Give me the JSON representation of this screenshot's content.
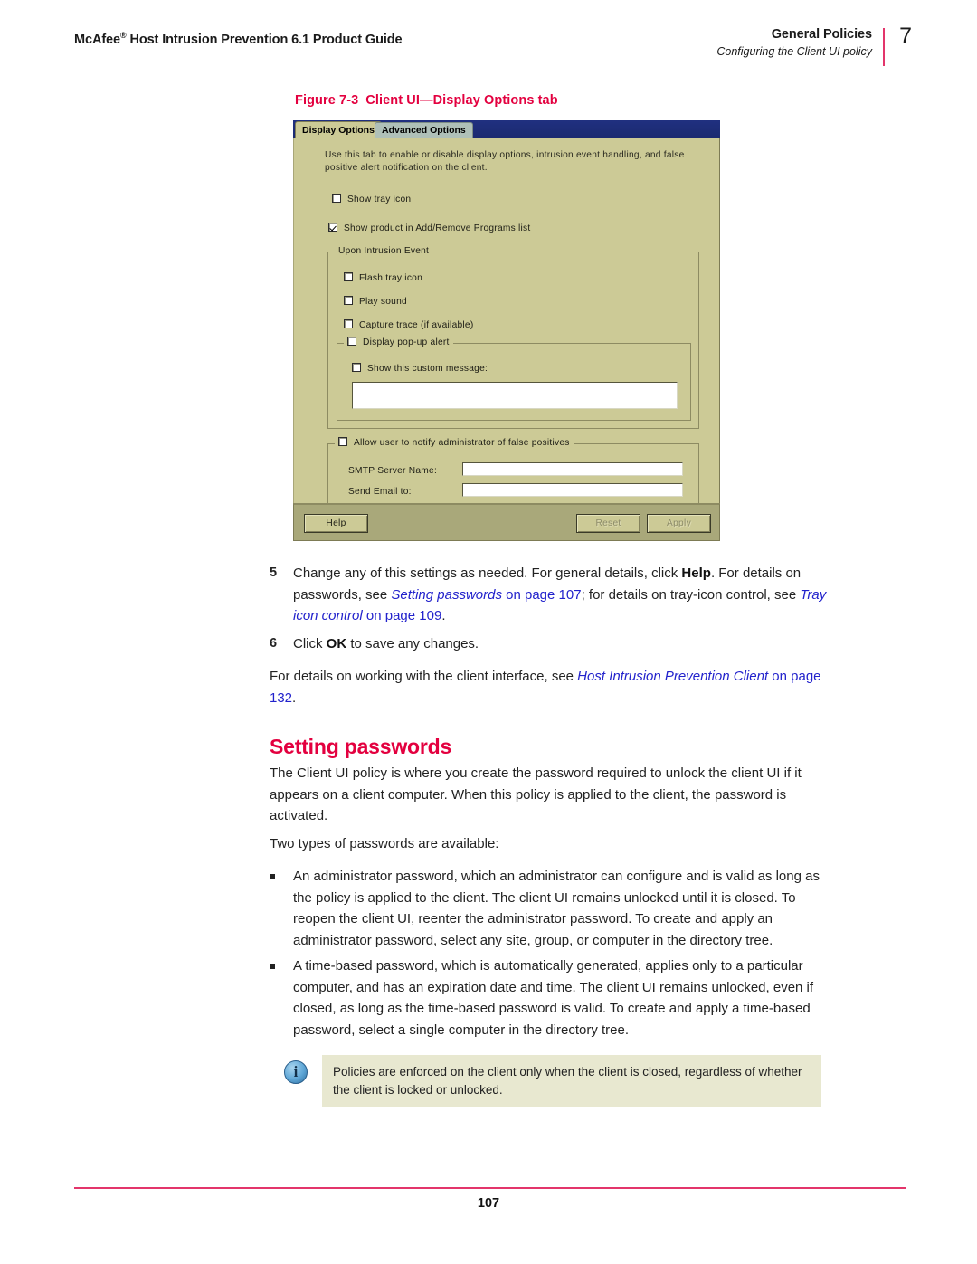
{
  "header": {
    "product_title": "McAfee",
    "product_title_sup": "®",
    "product_title_rest": " Host Intrusion Prevention 6.1 Product Guide",
    "chapter": "General Policies",
    "section": "Configuring the Client UI policy",
    "page_number": "7"
  },
  "figure": {
    "caption_number": "Figure 7-3",
    "caption_text": "Client UI—Display Options tab"
  },
  "dialog": {
    "tabs": [
      {
        "label": "Display Options",
        "active": true
      },
      {
        "label": "Advanced Options",
        "active": false
      }
    ],
    "intro_text": "Use this tab to enable or disable display options, intrusion event handling, and false positive alert notification on the client.",
    "checkboxes": {
      "show_tray_icon": "Show tray icon",
      "show_product_addremove": "Show product in Add/Remove Programs list",
      "flash_tray_icon": "Flash tray icon",
      "play_sound": "Play sound",
      "capture_trace": "Capture trace (if available)",
      "display_popup_alert": "Display pop-up alert",
      "show_custom_message": "Show this custom message:",
      "allow_user_notify": "Allow user to notify administrator of false positives"
    },
    "groups": {
      "upon_intrusion_event": "Upon Intrusion Event"
    },
    "fields": {
      "custom_message_value": "",
      "smtp_server_label": "SMTP Server Name:",
      "smtp_server_value": "",
      "send_email_label": "Send Email to:",
      "send_email_value": ""
    },
    "buttons": {
      "help": "Help",
      "reset": "Reset",
      "apply": "Apply"
    },
    "colors": {
      "dialog_background": "#CCCA96",
      "tabstrip_background": "#1F2E7A",
      "inactive_tab_background": "#AFC0B8",
      "footer_background": "#A9A87A"
    }
  },
  "steps": [
    {
      "number": "5",
      "parts": [
        {
          "t": "Change any of this settings as needed. For general details, click ",
          "style": "normal"
        },
        {
          "t": "Help",
          "style": "bold"
        },
        {
          "t": ". For details on passwords, see ",
          "style": "normal"
        },
        {
          "t": "Setting passwords",
          "style": "link-italic"
        },
        {
          "t": " on page 107",
          "style": "link"
        },
        {
          "t": "; for details on tray-icon control, see ",
          "style": "normal"
        },
        {
          "t": "Tray icon control",
          "style": "link-italic"
        },
        {
          "t": " on page 109",
          "style": "link"
        },
        {
          "t": ".",
          "style": "normal"
        }
      ]
    },
    {
      "number": "6",
      "parts": [
        {
          "t": "Click ",
          "style": "normal"
        },
        {
          "t": "OK",
          "style": "bold"
        },
        {
          "t": " to save any changes.",
          "style": "normal"
        }
      ]
    }
  ],
  "paragraphs": {
    "client_interface": [
      {
        "t": "For details on working with the client interface, see ",
        "style": "normal"
      },
      {
        "t": "Host Intrusion Prevention Client",
        "style": "link-italic"
      },
      {
        "t": " on page 132",
        "style": "link"
      },
      {
        "t": ".",
        "style": "normal"
      }
    ],
    "policy_intro": "The Client UI policy is where you create the password required to unlock the client UI if it appears on a client computer. When this policy is applied to the client, the password is activated.",
    "two_types": "Two types of passwords are available:"
  },
  "section_heading": "Setting passwords",
  "bullets": [
    "An administrator password, which an administrator can configure and is valid as long as the policy is applied to the client. The client UI remains unlocked until it is closed. To reopen the client UI, reenter the administrator password. To create and apply an administrator password, select any site, group, or computer in the directory tree.",
    "A time-based password, which is automatically generated, applies only to a particular computer, and has an expiration date and time. The client UI remains unlocked, even if closed, as long as the time-based password is valid. To create and apply a time-based password, select a single computer in the directory tree."
  ],
  "note": {
    "icon": "info-icon",
    "icon_glyph": "i",
    "text": "Policies are enforced on the client only when the client is closed, regardless of whether the client is locked or unlocked."
  },
  "footer": {
    "page_number": "107"
  },
  "colors": {
    "accent_red": "#E3003F",
    "rule_pink": "#E3356B",
    "link_blue": "#2222CC",
    "note_background": "#E8E8D0"
  }
}
